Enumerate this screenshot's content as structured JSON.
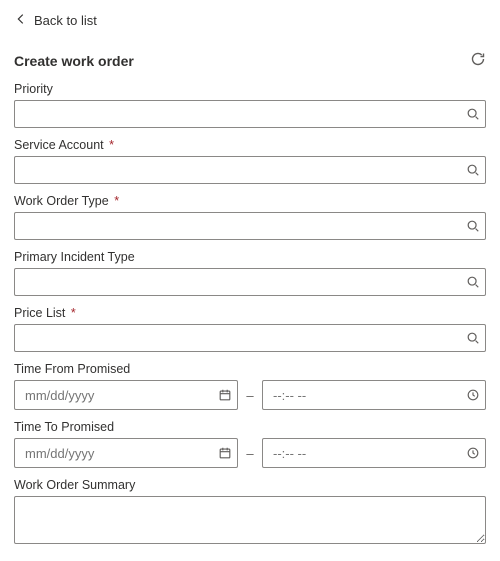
{
  "nav": {
    "back_label": "Back to list"
  },
  "header": {
    "title": "Create work order"
  },
  "fields": {
    "priority": {
      "label": "Priority",
      "required": false,
      "value": ""
    },
    "service_account": {
      "label": "Service Account",
      "required": true,
      "value": ""
    },
    "wo_type": {
      "label": "Work Order Type",
      "required": true,
      "value": ""
    },
    "incident_type": {
      "label": "Primary Incident Type",
      "required": false,
      "value": ""
    },
    "price_list": {
      "label": "Price List",
      "required": true,
      "value": ""
    },
    "time_from": {
      "label": "Time From Promised",
      "date_placeholder": "mm/dd/yyyy",
      "time_placeholder": "--:-- --",
      "date_value": "",
      "time_value": ""
    },
    "time_to": {
      "label": "Time To Promised",
      "date_placeholder": "mm/dd/yyyy",
      "time_placeholder": "--:-- --",
      "date_value": "",
      "time_value": ""
    },
    "summary": {
      "label": "Work Order Summary",
      "value": ""
    }
  },
  "req_marker": "*",
  "dash": "–"
}
